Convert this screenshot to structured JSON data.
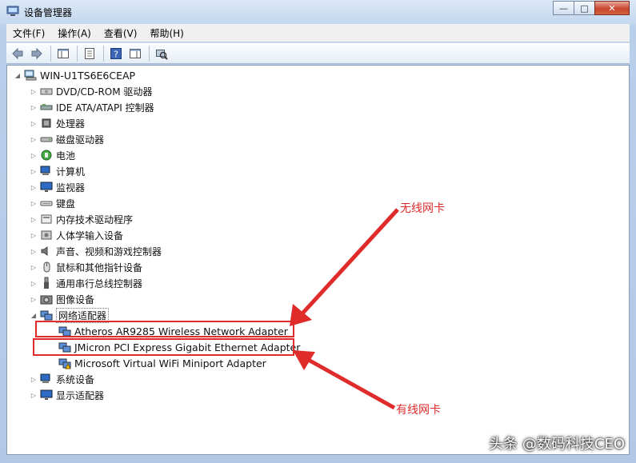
{
  "window": {
    "title": "设备管理器",
    "controls": {
      "minimize": "—",
      "maximize": "□",
      "close": "✕"
    }
  },
  "menu": [
    "文件(F)",
    "操作(A)",
    "查看(V)",
    "帮助(H)"
  ],
  "toolbar": {
    "icons": [
      "back-icon",
      "forward-icon",
      "show-hide-tree-icon",
      "properties-icon",
      "help-icon",
      "action-pane-icon",
      "scan-hardware-icon"
    ]
  },
  "tree": {
    "root": "WIN-U1TS6E6CEAP",
    "categories": [
      {
        "label": "DVD/CD-ROM 驱动器",
        "icon": "dvd-drive-icon"
      },
      {
        "label": "IDE ATA/ATAPI 控制器",
        "icon": "ide-controller-icon"
      },
      {
        "label": "处理器",
        "icon": "processor-icon"
      },
      {
        "label": "磁盘驱动器",
        "icon": "disk-drive-icon"
      },
      {
        "label": "电池",
        "icon": "battery-icon"
      },
      {
        "label": "计算机",
        "icon": "computer-icon"
      },
      {
        "label": "监视器",
        "icon": "monitor-icon"
      },
      {
        "label": "键盘",
        "icon": "keyboard-icon"
      },
      {
        "label": "内存技术驱动程序",
        "icon": "memory-tech-icon"
      },
      {
        "label": "人体学输入设备",
        "icon": "hid-icon"
      },
      {
        "label": "声音、视频和游戏控制器",
        "icon": "sound-icon"
      },
      {
        "label": "鼠标和其他指针设备",
        "icon": "mouse-icon"
      },
      {
        "label": "通用串行总线控制器",
        "icon": "usb-icon"
      },
      {
        "label": "图像设备",
        "icon": "imaging-icon"
      }
    ],
    "network": {
      "label": "网络适配器",
      "children": [
        {
          "label": "Atheros AR9285 Wireless Network Adapter",
          "warning": false
        },
        {
          "label": "JMicron PCI Express Gigabit Ethernet Adapter",
          "warning": false
        },
        {
          "label": "Microsoft Virtual WiFi Miniport Adapter",
          "warning": true
        }
      ]
    },
    "after": [
      {
        "label": "系统设备",
        "icon": "system-device-icon"
      },
      {
        "label": "显示适配器",
        "icon": "display-adapter-icon"
      }
    ]
  },
  "annotations": {
    "wireless": "无线网卡",
    "wired": "有线网卡",
    "color": "#e02b2b"
  },
  "watermark": "头条 @数码科技CEO"
}
